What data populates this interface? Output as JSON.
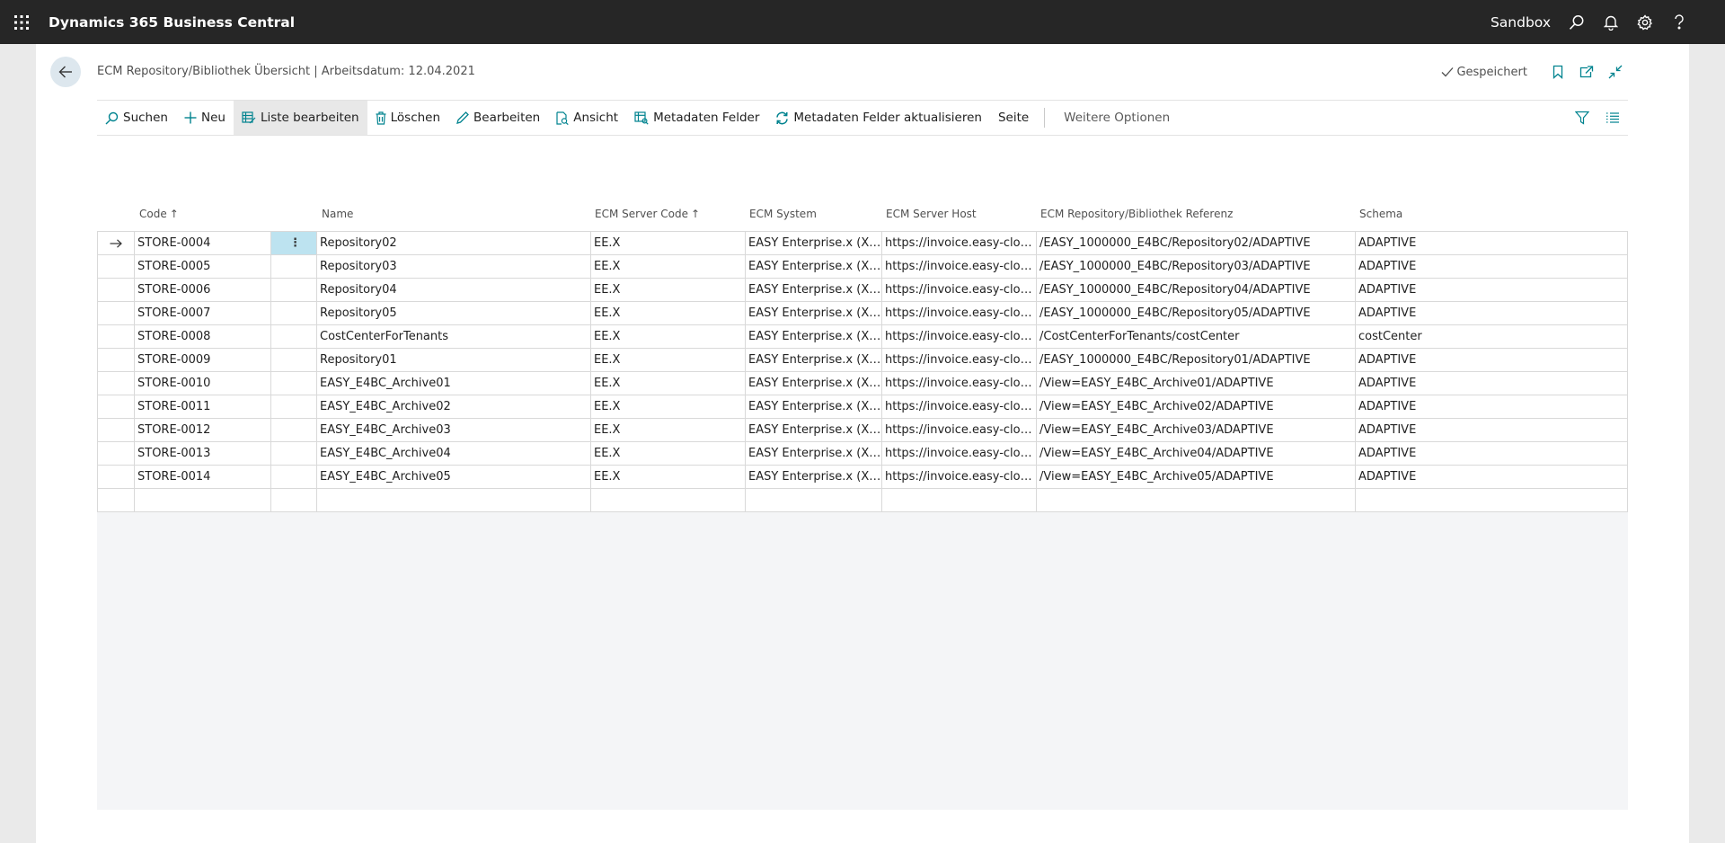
{
  "app": {
    "title": "Dynamics 365 Business Central",
    "environment": "Sandbox"
  },
  "topbar_icons": [
    "search-icon",
    "bell-icon",
    "gear-icon",
    "help-icon"
  ],
  "page": {
    "caption": "ECM Repository/Bibliothek Übersicht | Arbeitsdatum: 12.04.2021",
    "saved_label": "Gespeichert"
  },
  "actions": {
    "search": "Suchen",
    "new": "Neu",
    "edit_list": "Liste bearbeiten",
    "delete": "Löschen",
    "edit": "Bearbeiten",
    "view": "Ansicht",
    "metadata_fields": "Metadaten Felder",
    "metadata_refresh": "Metadaten Felder aktualisieren",
    "page": "Seite",
    "more": "Weitere Optionen"
  },
  "columns": {
    "code": "Code",
    "name": "Name",
    "server_code": "ECM Server Code",
    "system": "ECM System",
    "host": "ECM Server Host",
    "reference": "ECM Repository/Bibliothek Referenz",
    "schema": "Schema",
    "sort_glyph": "↑"
  },
  "rows": [
    {
      "code": "STORE-0004",
      "name": "Repository02",
      "server_code": "EE.X",
      "system": "EASY Enterprise.x (XM...",
      "host": "https://invoice.easy-clou...",
      "reference": "/EASY_1000000_E4BC/Repository02/ADAPTIVE",
      "schema": "ADAPTIVE"
    },
    {
      "code": "STORE-0005",
      "name": "Repository03",
      "server_code": "EE.X",
      "system": "EASY Enterprise.x (XM...",
      "host": "https://invoice.easy-clou...",
      "reference": "/EASY_1000000_E4BC/Repository03/ADAPTIVE",
      "schema": "ADAPTIVE"
    },
    {
      "code": "STORE-0006",
      "name": "Repository04",
      "server_code": "EE.X",
      "system": "EASY Enterprise.x (XM...",
      "host": "https://invoice.easy-clou...",
      "reference": "/EASY_1000000_E4BC/Repository04/ADAPTIVE",
      "schema": "ADAPTIVE"
    },
    {
      "code": "STORE-0007",
      "name": "Repository05",
      "server_code": "EE.X",
      "system": "EASY Enterprise.x (XM...",
      "host": "https://invoice.easy-clou...",
      "reference": "/EASY_1000000_E4BC/Repository05/ADAPTIVE",
      "schema": "ADAPTIVE"
    },
    {
      "code": "STORE-0008",
      "name": "CostCenterForTenants",
      "server_code": "EE.X",
      "system": "EASY Enterprise.x (XM...",
      "host": "https://invoice.easy-clou...",
      "reference": "/CostCenterForTenants/costCenter",
      "schema": "costCenter"
    },
    {
      "code": "STORE-0009",
      "name": "Repository01",
      "server_code": "EE.X",
      "system": "EASY Enterprise.x (XM...",
      "host": "https://invoice.easy-clou...",
      "reference": "/EASY_1000000_E4BC/Repository01/ADAPTIVE",
      "schema": "ADAPTIVE"
    },
    {
      "code": "STORE-0010",
      "name": "EASY_E4BC_Archive01",
      "server_code": "EE.X",
      "system": "EASY Enterprise.x (XM...",
      "host": "https://invoice.easy-clou...",
      "reference": "/View=EASY_E4BC_Archive01/ADAPTIVE",
      "schema": "ADAPTIVE"
    },
    {
      "code": "STORE-0011",
      "name": "EASY_E4BC_Archive02",
      "server_code": "EE.X",
      "system": "EASY Enterprise.x (XM...",
      "host": "https://invoice.easy-clou...",
      "reference": "/View=EASY_E4BC_Archive02/ADAPTIVE",
      "schema": "ADAPTIVE"
    },
    {
      "code": "STORE-0012",
      "name": "EASY_E4BC_Archive03",
      "server_code": "EE.X",
      "system": "EASY Enterprise.x (XM...",
      "host": "https://invoice.easy-clou...",
      "reference": "/View=EASY_E4BC_Archive03/ADAPTIVE",
      "schema": "ADAPTIVE"
    },
    {
      "code": "STORE-0013",
      "name": "EASY_E4BC_Archive04",
      "server_code": "EE.X",
      "system": "EASY Enterprise.x (XM...",
      "host": "https://invoice.easy-clou...",
      "reference": "/View=EASY_E4BC_Archive04/ADAPTIVE",
      "schema": "ADAPTIVE"
    },
    {
      "code": "STORE-0014",
      "name": "EASY_E4BC_Archive05",
      "server_code": "EE.X",
      "system": "EASY Enterprise.x (XM...",
      "host": "https://invoice.easy-clou...",
      "reference": "/View=EASY_E4BC_Archive05/ADAPTIVE",
      "schema": "ADAPTIVE"
    },
    {
      "code": "",
      "name": "",
      "server_code": "",
      "system": "",
      "host": "",
      "reference": "",
      "schema": ""
    }
  ],
  "selected_row": 0,
  "colors": {
    "topbar": "#262626",
    "accent": "#00838f",
    "selection": "#bde3f0"
  }
}
